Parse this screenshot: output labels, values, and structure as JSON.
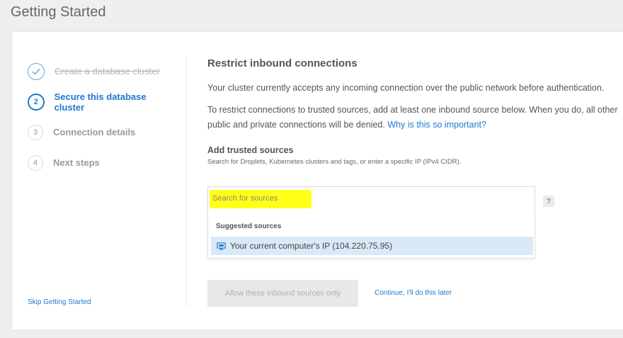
{
  "page": {
    "title": "Getting Started"
  },
  "steps": [
    {
      "number": "✓",
      "label": "Create a database cluster",
      "state": "done"
    },
    {
      "number": "2",
      "label": "Secure this database cluster",
      "state": "active"
    },
    {
      "number": "3",
      "label": "Connection details",
      "state": "pending"
    },
    {
      "number": "4",
      "label": "Next steps",
      "state": "pending"
    }
  ],
  "skip": {
    "label": "Skip Getting Started"
  },
  "main": {
    "title": "Restrict inbound connections",
    "para1": "Your cluster currently accepts any incoming connection over the public network before authentication.",
    "para2": "To restrict connections to trusted sources, add at least one inbound source below. When you do, all other public and private connections will be denied.",
    "para2_link": "Why is this so important?",
    "add_title": "Add trusted sources",
    "add_help": "Search for Droplets, Kubernetes clusters and tags, or enter a specific IP (IPv4 CIDR).",
    "search": {
      "placeholder": "Search for sources",
      "value": ""
    },
    "help_label": "?",
    "dropdown": {
      "header": "Suggested sources",
      "item": "Your current computer's IP (104.220.75.95)",
      "item_icon": "computer-icon"
    },
    "allow_button": "Allow these inbound sources only",
    "continue_link": "Continue, I'll do this later"
  },
  "colors": {
    "accent": "#1f78d1",
    "highlight": "#ffff1a",
    "selected_row": "#d9e9f7"
  }
}
